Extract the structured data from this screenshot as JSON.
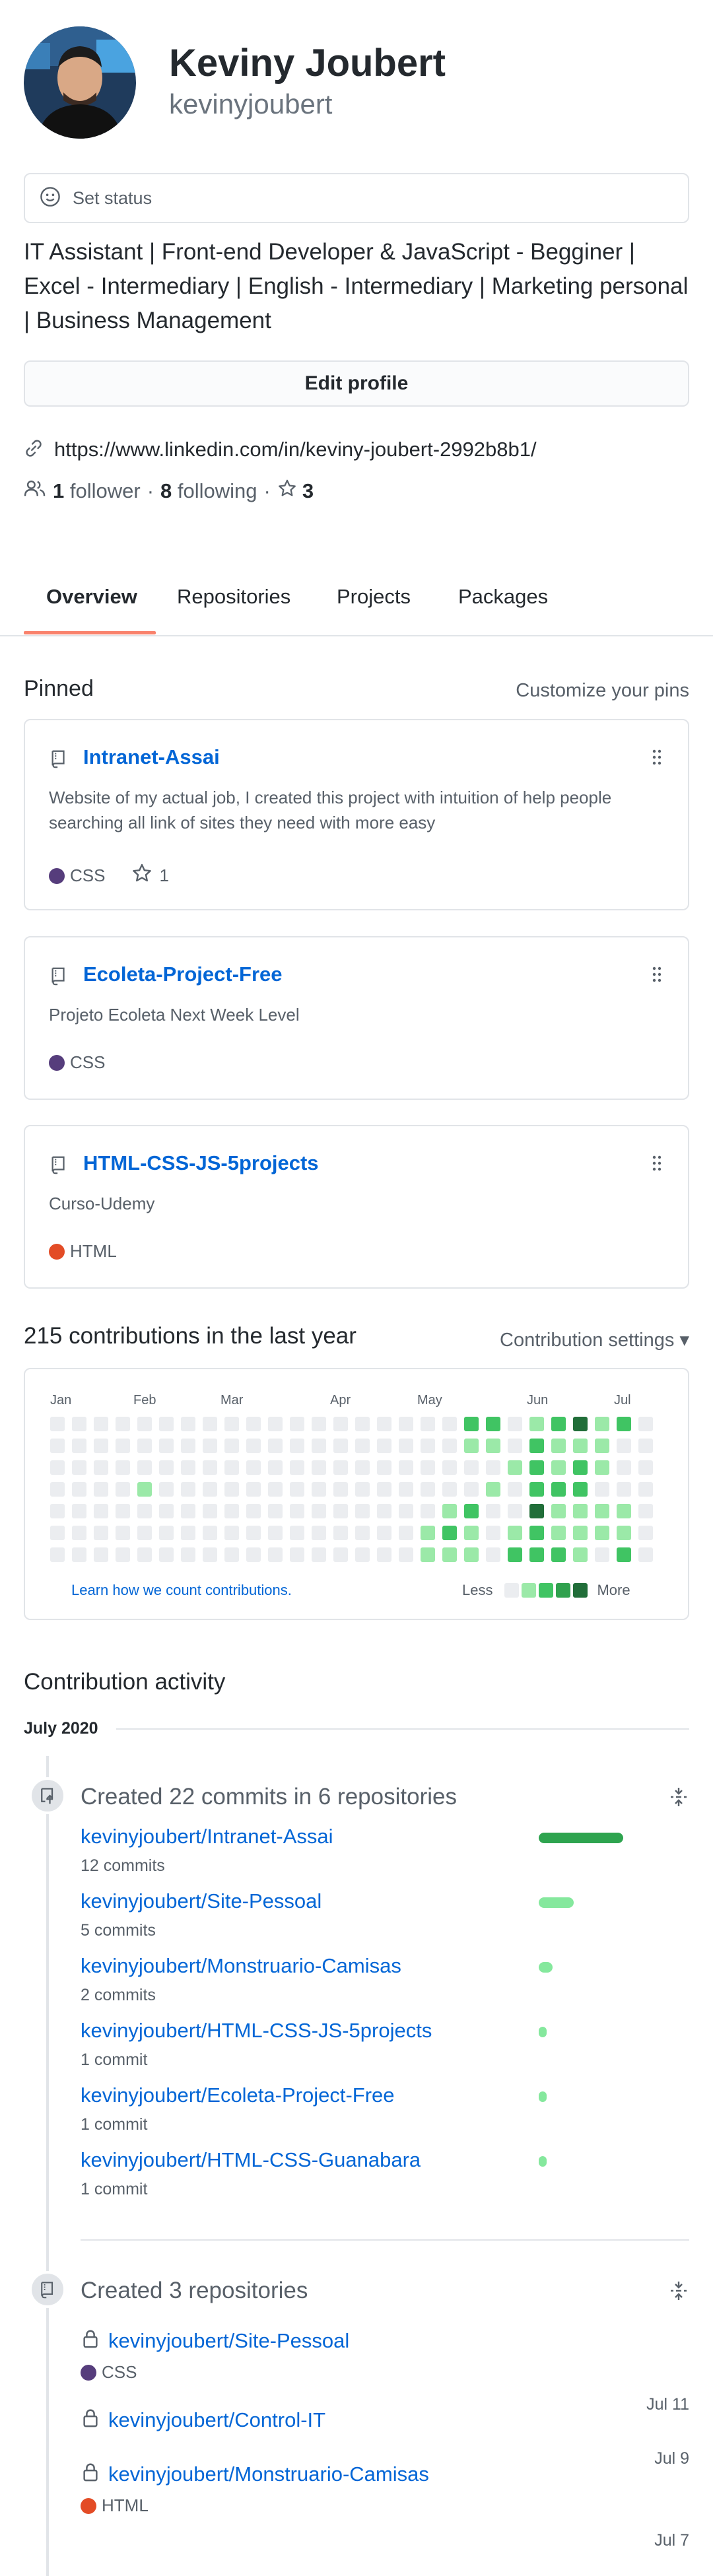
{
  "profile": {
    "name": "Keviny Joubert",
    "login": "kevinyjoubert",
    "status_label": "Set status",
    "bio": "IT Assistant | Front-end Developer & JavaScript - Begginer | Excel - Intermediary | English - Intermediary | Marketing personal | Business Management",
    "edit_label": "Edit profile",
    "website": "https://www.linkedin.com/in/keviny-joubert-2992b8b1/",
    "followers_count": "1",
    "followers_label": "follower",
    "following_count": "8",
    "following_label": "following",
    "stars_count": "3"
  },
  "tabs": [
    {
      "label": "Overview",
      "active": true
    },
    {
      "label": "Repositories"
    },
    {
      "label": "Projects"
    },
    {
      "label": "Packages"
    }
  ],
  "pinned": {
    "title": "Pinned",
    "customize_label": "Customize your pins",
    "cards": [
      {
        "name": "Intranet-Assai",
        "description": "Website of my actual job, I created this project with intuition of help people searching all link of sites they need with more easy",
        "language": "CSS",
        "language_color": "#563d7c",
        "stars": "1"
      },
      {
        "name": "Ecoleta-Project-Free",
        "description": "Projeto Ecoleta Next Week Level",
        "language": "CSS",
        "language_color": "#563d7c"
      },
      {
        "name": "HTML-CSS-JS-5projects",
        "description": "Curso-Udemy",
        "language": "HTML",
        "language_color": "#e34c26"
      }
    ]
  },
  "contributions": {
    "title": "215 contributions in the last year",
    "settings_label": "Contribution settings",
    "months": [
      "Jan",
      "Feb",
      "Mar",
      "Apr",
      "May",
      "Jun",
      "Jul"
    ],
    "learn_label": "Learn how we count contributions.",
    "less_label": "Less",
    "more_label": "More",
    "level_colors": [
      "#ebedf0",
      "#9be9a8",
      "#40c463",
      "#30a14e",
      "#216e39"
    ]
  },
  "activity": {
    "title": "Contribution activity",
    "month_label": "July 2020",
    "commits_header": "Created 22 commits in 6 repositories",
    "commit_repos": [
      {
        "name": "kevinyjoubert/Intranet-Assai",
        "count": "12 commits",
        "commits": 12
      },
      {
        "name": "kevinyjoubert/Site-Pessoal",
        "count": "5 commits",
        "commits": 5
      },
      {
        "name": "kevinyjoubert/Monstruario-Camisas",
        "count": "2 commits",
        "commits": 2
      },
      {
        "name": "kevinyjoubert/HTML-CSS-JS-5projects",
        "count": "1 commit",
        "commits": 1
      },
      {
        "name": "kevinyjoubert/Ecoleta-Project-Free",
        "count": "1 commit",
        "commits": 1
      },
      {
        "name": "kevinyjoubert/HTML-CSS-Guanabara",
        "count": "1 commit",
        "commits": 1
      }
    ],
    "repos_header": "Created 3 repositories",
    "created_repos": [
      {
        "name": "kevinyjoubert/Site-Pessoal",
        "language": "CSS",
        "language_color": "#563d7c",
        "date": "Jul 11"
      },
      {
        "name": "kevinyjoubert/Control-IT",
        "language": "",
        "date": "Jul 9"
      },
      {
        "name": "kevinyjoubert/Monstruario-Camisas",
        "language": "HTML",
        "language_color": "#e34c26",
        "date": "Jul 7"
      }
    ]
  }
}
